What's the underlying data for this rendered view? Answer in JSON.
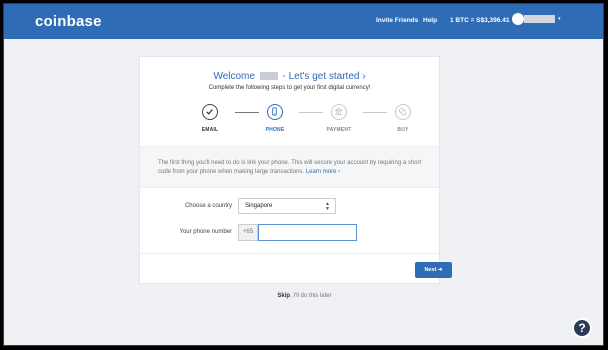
{
  "header": {
    "logo": "coinbase",
    "invite_friends": "Invite Friends",
    "help": "Help",
    "btc_price": "1 BTC = S$3,396.41",
    "caret": "▾"
  },
  "onboarding": {
    "welcome_prefix": "Welcome",
    "welcome_suffix": "- Let's get started ›",
    "subtitle": "Complete the following steps to get your first digital currency!",
    "steps": [
      {
        "label": "EMAIL",
        "state": "done",
        "icon": "checkmark-icon"
      },
      {
        "label": "PHONE",
        "state": "active",
        "icon": "phone-icon"
      },
      {
        "label": "PAYMENT",
        "state": "pending",
        "icon": "bank-icon"
      },
      {
        "label": "BUY",
        "state": "pending",
        "icon": "coins-icon"
      }
    ],
    "info_text": "The first thing you'll need to do is link your phone. This will secure your account by requiring a short code from your phone when making large transactions.",
    "learn_more": "Learn more ›",
    "country_label": "Choose a country",
    "country_value": "Singapore",
    "phone_label": "Your phone number",
    "phone_prefix": "+65",
    "phone_value": "",
    "next_label": "Next ➜"
  },
  "footer": {
    "skip": "Skip",
    "skip_rest": ", I'll do this later"
  },
  "help_button": "?",
  "colors": {
    "brand": "#2f6cb6",
    "background": "#f0f1f4",
    "help_bg": "#2b3b55"
  }
}
